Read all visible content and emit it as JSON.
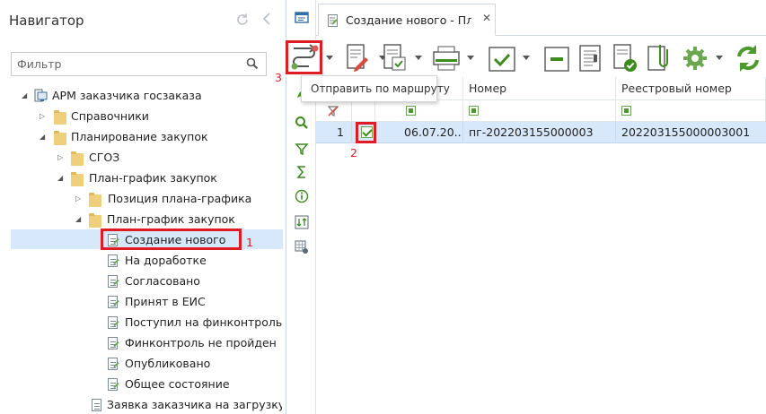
{
  "navigator": {
    "title": "Навигатор",
    "filter_placeholder": "Фильтр",
    "tree": [
      {
        "label": "АРМ заказчика госзаказа"
      },
      {
        "label": "Справочники"
      },
      {
        "label": "Планирование закупок"
      },
      {
        "label": "СГОЗ"
      },
      {
        "label": "План-график закупок"
      },
      {
        "label": "Позиция плана-графика"
      },
      {
        "label": "План-график закупок"
      },
      {
        "label": "Создание нового"
      },
      {
        "label": "На доработке"
      },
      {
        "label": "Согласовано"
      },
      {
        "label": "Принят в ЕИС"
      },
      {
        "label": "Поступил на финконтроль"
      },
      {
        "label": "Финконтроль не пройден"
      },
      {
        "label": "Опубликовано"
      },
      {
        "label": "Общее состояние"
      },
      {
        "label": "Заявка заказчика на загрузку ..."
      }
    ]
  },
  "tab": {
    "label": "Создание нового - План...",
    "close": "✕"
  },
  "tooltip": "Отправить по маршруту",
  "annotations": {
    "one": "1",
    "two": "2",
    "three": "3"
  },
  "grid": {
    "headers": [
      "",
      "",
      "",
      "Номер",
      "Реестровый номер"
    ],
    "rows": [
      {
        "index": "1",
        "date": "06.07.20...",
        "number": "пг-202203155000003",
        "registry": "202203155000003001"
      }
    ]
  },
  "colors": {
    "accent": "#e01b24",
    "selection": "#d6e8f9",
    "green": "#4c9a2a"
  }
}
